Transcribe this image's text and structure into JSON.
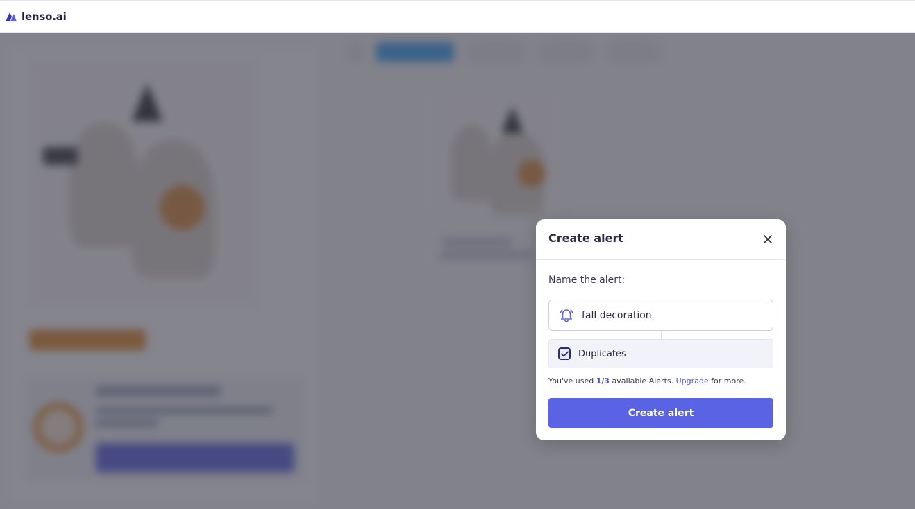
{
  "header": {
    "logo_text": "lenso.ai",
    "brand_color": "#3b3fd6"
  },
  "modal": {
    "title": "Create alert",
    "close_icon": "close-icon",
    "name_label": "Name the alert:",
    "name_value": "fall decoration",
    "input_icon": "bell-icon",
    "duplicates_label": "Duplicates",
    "duplicates_checked": true,
    "usage_prefix": "You've used",
    "usage_count": "1/3",
    "usage_middle": "available Alerts.",
    "upgrade_link": "Upgrade",
    "usage_suffix": "for more.",
    "create_button": "Create alert",
    "accent_color": "#5a63e4"
  }
}
